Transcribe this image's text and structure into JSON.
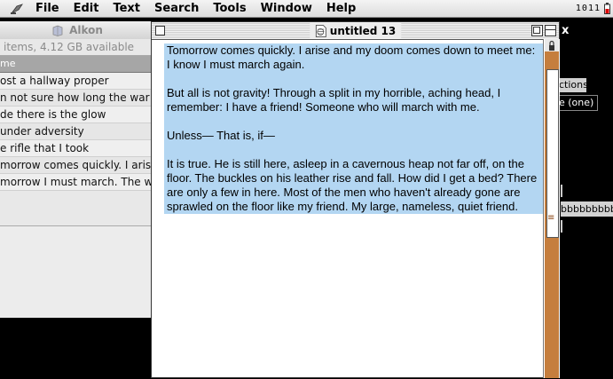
{
  "menubar": {
    "items": [
      "File",
      "Edit",
      "Text",
      "Search",
      "Tools",
      "Window",
      "Help"
    ],
    "clock": "1011"
  },
  "finder": {
    "title": "Alkon",
    "info": "items, 4.12 GB available",
    "column_header": "me",
    "rows": [
      "ost a hallway proper",
      "n not sure how long the war",
      "de there is the glow",
      "under adversity",
      "e rifle that I took",
      "morrow comes quickly. I arise",
      "morrow I must march. The wo"
    ]
  },
  "right": {
    "close": "x",
    "panel1": "ctions",
    "panel2": "e (one)",
    "panel3": "bbbbbbbbbb"
  },
  "editor": {
    "title": "untitled 13",
    "paragraphs": [
      "Tomorrow comes quickly. I arise and my doom comes down to meet me: I know I must march again.",
      "But all is not gravity! Through a split in my horrible, aching head, I remember: I have a friend! Someone who will march with me.",
      "Unless— That is, if—",
      "It is true. He is still here, asleep in a cavernous heap not far off, on the floor. The buckles on his leather rise and fall. How did I get a bed? There are only a few in here. Most of the men who haven't already gone are sprawled on the floor like my friend. My large, nameless, quiet friend."
    ]
  },
  "colors": {
    "selection": "#b3d6f2",
    "scroll_track": "#c57e3e"
  },
  "icons": [
    "apple-icon",
    "volume-icon",
    "document-icon",
    "battery-icon"
  ]
}
